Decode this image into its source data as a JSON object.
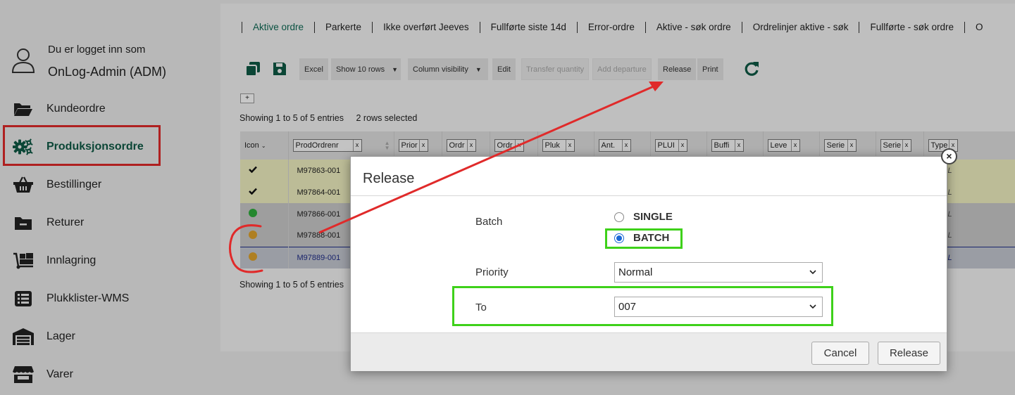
{
  "sidebar": {
    "user_line1": "Du er logget inn som",
    "user_line2": "OnLog-Admin (ADM)",
    "items": [
      {
        "label": "Kundeordre",
        "icon": "folder-open-icon"
      },
      {
        "label": "Produksjonsordre",
        "icon": "gears-icon",
        "active": true
      },
      {
        "label": "Bestillinger",
        "icon": "basket-icon"
      },
      {
        "label": "Returer",
        "icon": "folder-minus-icon"
      },
      {
        "label": "Innlagring",
        "icon": "dolly-icon"
      },
      {
        "label": "Plukklister-WMS",
        "icon": "list-icon"
      },
      {
        "label": "Lager",
        "icon": "warehouse-icon"
      },
      {
        "label": "Varer",
        "icon": "store-icon"
      }
    ]
  },
  "tabs": [
    "Aktive ordre",
    "Parkerte",
    "Ikke overført Jeeves",
    "Fullførte siste 14d",
    "Error-ordre",
    "Aktive - søk ordre",
    "Ordrelinjer aktive - søk",
    "Fullførte - søk ordre",
    "O"
  ],
  "toolbar": {
    "excel": "Excel",
    "show_rows": "Show 10 rows",
    "column_visibility": "Column visibility",
    "edit": "Edit",
    "transfer_quantity": "Transfer quantity",
    "add_departure": "Add departure",
    "release": "Release",
    "print": "Print",
    "copy_icon": "copy-icon",
    "save_icon": "save-icon",
    "refresh_icon": "refresh-icon"
  },
  "table": {
    "expand_label": "+",
    "info_top": "Showing 1 to 5 of 5 entries",
    "selected_info": "2 rows selected",
    "info_bottom": "Showing 1 to 5 of 5 entries",
    "columns": [
      "Icon",
      "ProdOrdrenr",
      "Prior",
      "Ordr",
      "Ordr",
      "Pluk",
      "Ant.",
      "PLUI",
      "Buffi",
      "Leve",
      "Serie",
      "Serie",
      "Type"
    ],
    "rows": [
      {
        "status": "check",
        "prod_ordrenr": "M97863-001",
        "type": "NULL",
        "style": "yellow"
      },
      {
        "status": "check",
        "prod_ordrenr": "M97864-001",
        "type": "NULL",
        "style": "yellow"
      },
      {
        "status": "green-dot",
        "prod_ordrenr": "M97866-001",
        "type": "NULL",
        "style": "gray"
      },
      {
        "status": "orange-dot",
        "prod_ordrenr": "M97888-001",
        "type": "NULL",
        "style": "gray"
      },
      {
        "status": "orange-dot",
        "prod_ordrenr": "M97889-001",
        "type": "NULL",
        "style": "blue"
      }
    ]
  },
  "dialog": {
    "title": "Release",
    "close_label": "×",
    "batch_label": "Batch",
    "option_single": "SINGLE",
    "option_batch": "BATCH",
    "selected_option": "BATCH",
    "priority_label": "Priority",
    "priority_value": "Normal",
    "to_label": "To",
    "to_value": "007",
    "cancel_label": "Cancel",
    "release_label": "Release"
  },
  "colors": {
    "brand_green": "#0f5a46",
    "annotation_red": "#e02a2a",
    "annotation_green": "#3ed11a",
    "radio_blue": "#1a67d6"
  }
}
